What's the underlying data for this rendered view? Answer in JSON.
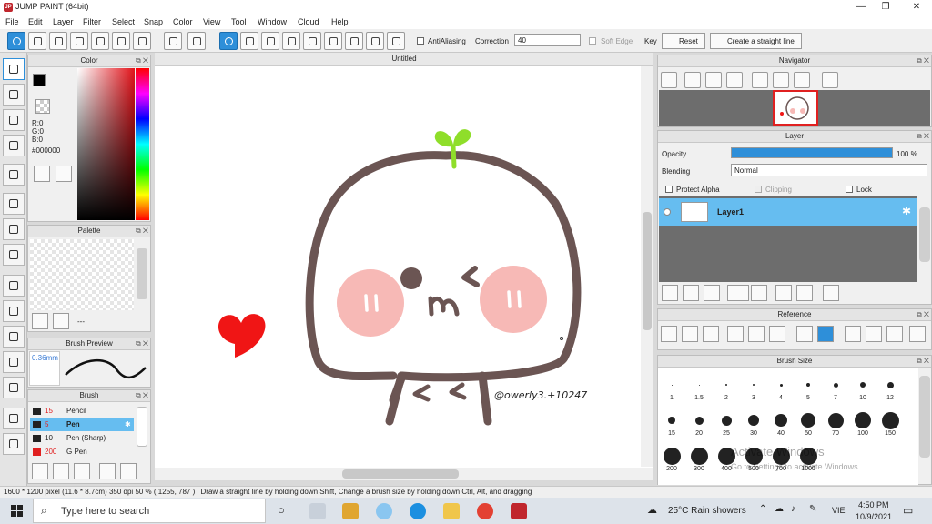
{
  "window": {
    "title": "JUMP PAINT (64bit)",
    "minimize": "—",
    "restore": "❐",
    "close": "✕"
  },
  "menu": [
    "File",
    "Edit",
    "Layer",
    "Filter",
    "Select",
    "Snap",
    "Color",
    "View",
    "Tool",
    "Window",
    "Cloud",
    "Help"
  ],
  "toolbar": {
    "antialiasing_label": "AntiAliasing",
    "correction_label": "Correction",
    "correction_value": "40",
    "soft_edge_label": "Soft Edge",
    "key_label": "Key",
    "reset_label": "Reset",
    "straight_line_label": "Create a straight line"
  },
  "color_panel": {
    "title": "Color",
    "r": "R:0",
    "g": "G:0",
    "b": "B:0",
    "hex": "#000000",
    "fg_color": "#000000",
    "bg_color": "#f28db2"
  },
  "palette_panel": {
    "title": "Palette",
    "dash": "---"
  },
  "brush_preview": {
    "title": "Brush Preview",
    "size": "0.36mm"
  },
  "brush_panel": {
    "title": "Brush",
    "items": [
      {
        "size": "15",
        "name": "Pencil",
        "color": "#222222"
      },
      {
        "size": "5",
        "name": "Pen",
        "color": "#222222"
      },
      {
        "size": "10",
        "name": "Pen (Sharp)",
        "color": "#222222"
      },
      {
        "size": "200",
        "name": "G Pen",
        "color": "#e02020"
      }
    ]
  },
  "document": {
    "tab_title": "Untitled",
    "signature": "@owerly3.+10247"
  },
  "navigator": {
    "title": "Navigator"
  },
  "layer_panel": {
    "title": "Layer",
    "opacity_label": "Opacity",
    "opacity_value": "100 %",
    "opacity": 1.0,
    "blending_label": "Blending",
    "blending_value": "Normal",
    "protect_alpha": "Protect Alpha",
    "clipping": "Clipping",
    "lock": "Lock",
    "layer_name": "Layer1"
  },
  "reference_panel": {
    "title": "Reference"
  },
  "brush_size_panel": {
    "title": "Brush Size",
    "rows": [
      [
        "1",
        "1.5",
        "2",
        "3",
        "4",
        "5",
        "7",
        "10",
        "12"
      ],
      [
        "15",
        "20",
        "25",
        "30",
        "40",
        "50",
        "70",
        "100",
        "150"
      ],
      [
        "200",
        "300",
        "400",
        "500",
        "700",
        "1000"
      ]
    ],
    "watermark_1": "Activate Windows",
    "watermark_2": "Go to Settings to activate Windows."
  },
  "status": {
    "size": "1600 * 1200 pixel",
    "physical": "(11.6 * 8.7cm)",
    "dpi": "350 dpi",
    "zoom": "50 %",
    "coords": "( 1255, 787 )",
    "hint": "Draw a straight line by holding down Shift, Change a brush size by holding down Ctrl, Alt, and dragging"
  },
  "taskbar": {
    "search_placeholder": "Type here to search",
    "weather": "25°C  Rain showers",
    "lang": "VIE",
    "time": "4:50 PM",
    "date": "10/9/2021"
  },
  "colors": {
    "accent": "#2e8fd9",
    "layer_selected": "#66bdf0",
    "char_outline": "#6b5553",
    "cheek": "#f7b9b6",
    "sprout": "#8fde2a",
    "heart": "#f01515"
  }
}
